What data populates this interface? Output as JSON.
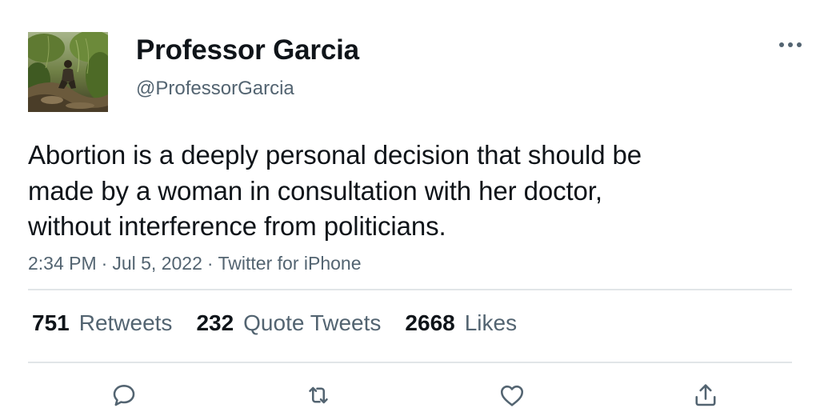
{
  "tweet": {
    "author": {
      "display_name": "Professor Garcia",
      "handle": "@ProfessorGarcia"
    },
    "text": "Abortion is a deeply personal decision that should be\nmade by a woman in consultation with her doctor,\nwithout interference from politicians.",
    "meta": {
      "time": "2:34 PM",
      "separator": "·",
      "date": "Jul 5, 2022",
      "source": "Twitter for iPhone"
    },
    "stats": {
      "retweets": {
        "count": "751",
        "label": "Retweets"
      },
      "quote_tweets": {
        "count": "232",
        "label": "Quote Tweets"
      },
      "likes": {
        "count": "2668",
        "label": "Likes"
      }
    },
    "icons": {
      "more": "more-dots-icon",
      "reply": "reply-icon",
      "retweet": "retweet-icon",
      "like": "heart-icon",
      "share": "share-icon"
    },
    "colors": {
      "text_primary": "#0f1419",
      "text_secondary": "#536471",
      "divider": "#e1e5e8"
    }
  }
}
